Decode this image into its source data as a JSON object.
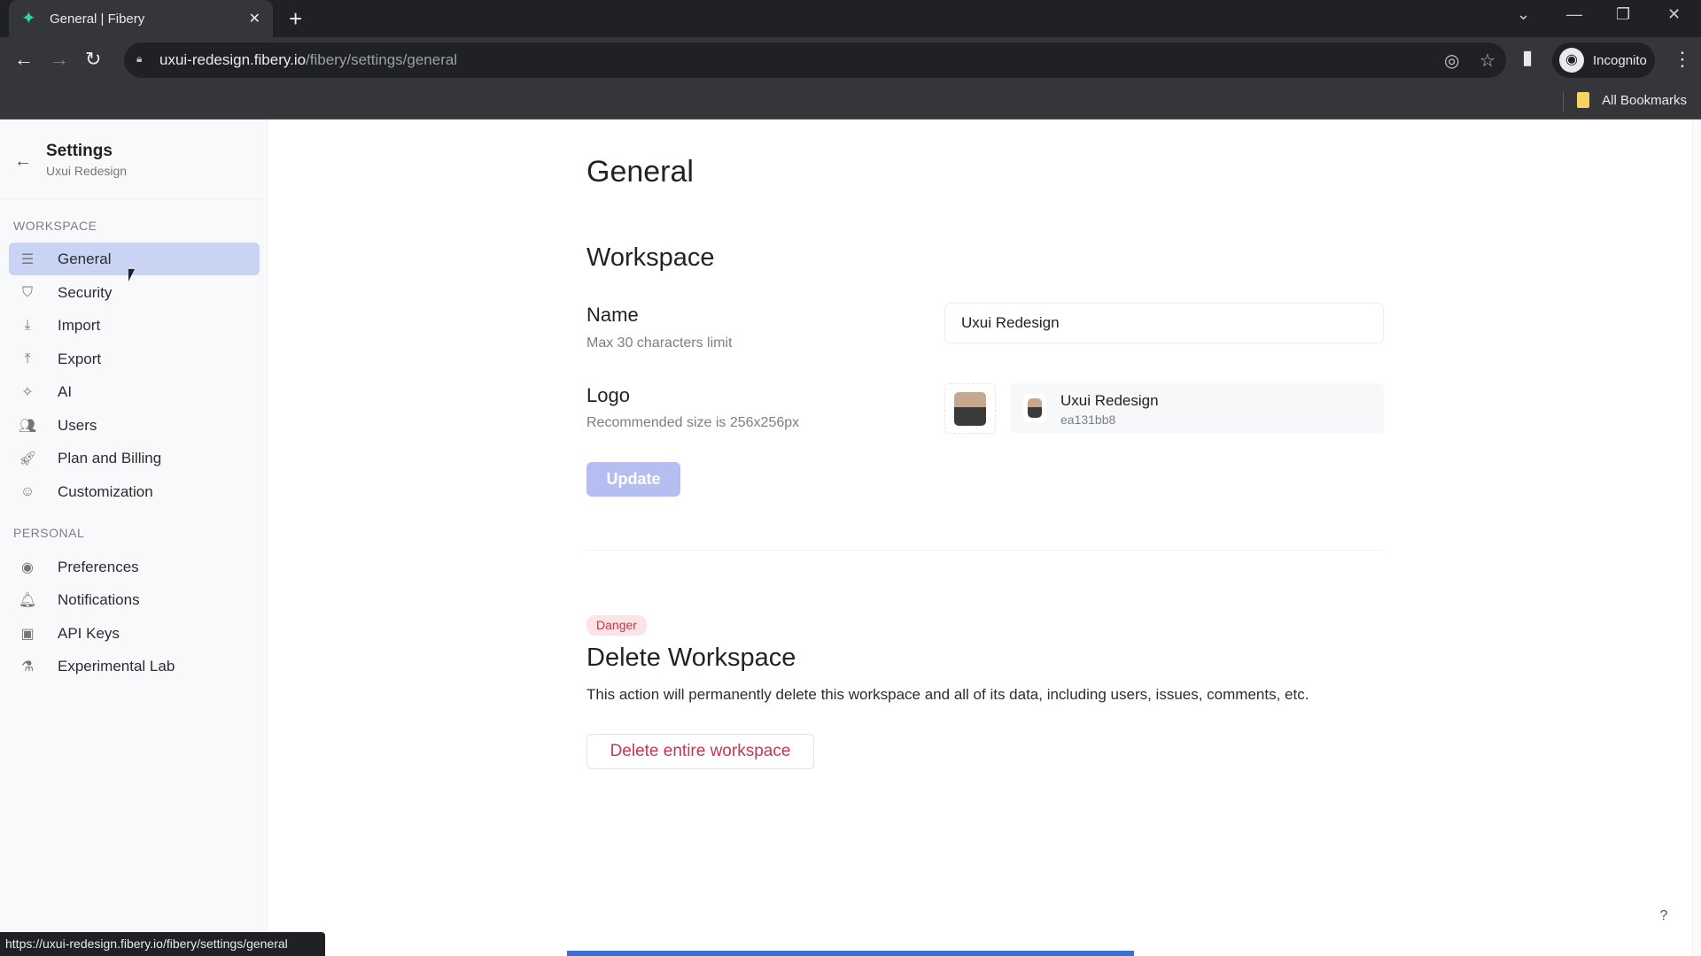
{
  "browser": {
    "tab_title": "General | Fibery",
    "url_host": "uxui-redesign.fibery.io",
    "url_path": "/fibery/settings/general",
    "profile_label": "Incognito",
    "bookmarks_label": "All Bookmarks",
    "status_url": "https://uxui-redesign.fibery.io/fibery/settings/general",
    "page_load_progress": 0.5
  },
  "sidebar": {
    "title": "Settings",
    "subtitle": "Uxui Redesign",
    "sections": [
      {
        "label": "WORKSPACE",
        "items": [
          {
            "label": "General",
            "icon": "sliders-icon",
            "active": true
          },
          {
            "label": "Security",
            "icon": "shield-icon"
          },
          {
            "label": "Import",
            "icon": "import-icon"
          },
          {
            "label": "Export",
            "icon": "export-icon"
          },
          {
            "label": "AI",
            "icon": "sparkle-icon"
          },
          {
            "label": "Users",
            "icon": "users-icon"
          },
          {
            "label": "Plan and Billing",
            "icon": "rocket-icon"
          },
          {
            "label": "Customization",
            "icon": "smiley-icon"
          }
        ]
      },
      {
        "label": "PERSONAL",
        "items": [
          {
            "label": "Preferences",
            "icon": "user-circle-icon"
          },
          {
            "label": "Notifications",
            "icon": "bell-icon"
          },
          {
            "label": "API Keys",
            "icon": "terminal-icon"
          },
          {
            "label": "Experimental Lab",
            "icon": "flask-icon"
          }
        ]
      }
    ]
  },
  "main": {
    "title": "General",
    "workspace": {
      "heading": "Workspace",
      "name_label": "Name",
      "name_hint": "Max 30 characters limit",
      "name_value": "Uxui Redesign",
      "logo_label": "Logo",
      "logo_hint": "Recommended size is 256x256px",
      "logo_name": "Uxui Redesign",
      "logo_id": "ea131bb8",
      "update_label": "Update"
    },
    "danger": {
      "badge": "Danger",
      "heading": "Delete Workspace",
      "description": "This action will permanently delete this workspace and all of its data, including users, issues, comments, etc.",
      "button_label": "Delete entire workspace"
    },
    "help_label": "?"
  }
}
